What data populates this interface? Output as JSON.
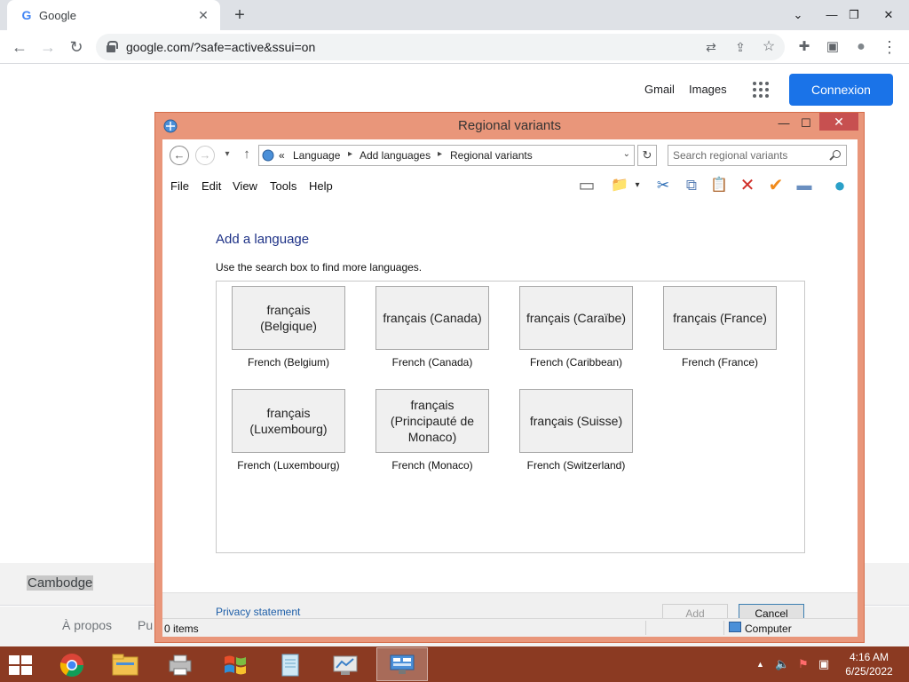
{
  "browser": {
    "tab": {
      "favicon": "G",
      "title": "Google",
      "close": "✕"
    },
    "new_tab": "+",
    "window_controls": {
      "chevron": "⌄",
      "minimize": "—",
      "restore": "❐",
      "close": "✕"
    },
    "nav": {
      "back": "←",
      "forward": "→",
      "reload": "↻"
    },
    "url": "google.com/?safe=active&ssui=on",
    "omni_icons": {
      "translate": "⇄",
      "share": "⇪",
      "bookmark": "☆"
    },
    "extensions": {
      "puzzle": "✚",
      "sidepanel": "▣",
      "profile": "●",
      "menu": "⋮"
    }
  },
  "google": {
    "gmail": "Gmail",
    "images": "Images",
    "sign_in": "Connexion",
    "country": "Cambodge",
    "footer_links": [
      "À propos",
      "Pu"
    ]
  },
  "dialog": {
    "title": "Regional variants",
    "controls": {
      "minimize": "—",
      "maximize": "☐",
      "close": "✕"
    },
    "nav": {
      "back": "←",
      "forward": "→",
      "recent": "▾",
      "up": "↑"
    },
    "breadcrumb": {
      "prefix": "«",
      "items": [
        "Language",
        "Add languages",
        "Regional variants"
      ],
      "separator": "▸",
      "dropdown": "⌄"
    },
    "refresh": "↻",
    "search_placeholder": "Search regional variants",
    "menu": [
      "File",
      "Edit",
      "View",
      "Tools",
      "Help"
    ],
    "toolbar_icons": {
      "layout": "▭",
      "folder": "📁",
      "dropdown": "▾",
      "cut": "✂",
      "copy": "⧉",
      "paste": "📋",
      "delete": "✕",
      "check": "✔",
      "rename": "▬",
      "globe": "●"
    },
    "heading": "Add a language",
    "hint": "Use the search box to find more languages.",
    "languages": [
      {
        "native": "français (Belgique)",
        "english": "French (Belgium)"
      },
      {
        "native": "français (Canada)",
        "english": "French (Canada)"
      },
      {
        "native": "français (Caraïbe)",
        "english": "French (Caribbean)"
      },
      {
        "native": "français (France)",
        "english": "French (France)"
      },
      {
        "native": "français (Luxembourg)",
        "english": "French (Luxembourg)"
      },
      {
        "native": "français (Principauté de Monaco)",
        "english": "French (Monaco)"
      },
      {
        "native": "français (Suisse)",
        "english": "French (Switzerland)"
      }
    ],
    "privacy": "Privacy statement",
    "add_button": "Add",
    "cancel_button": "Cancel",
    "status_items": "0 items",
    "status_zone": "Computer"
  },
  "taskbar": {
    "apps": [
      "chrome",
      "file-explorer",
      "printer",
      "windows-logo",
      "notepad",
      "control-panel",
      "network-settings"
    ],
    "tray": {
      "up": "▲",
      "volume": "🔈",
      "flag": "⚑",
      "network": "▣"
    },
    "time": "4:16 AM",
    "date": "6/25/2022"
  },
  "colors": {
    "accent_blue": "#1a73e8",
    "dialog_frame": "#e9967a",
    "taskbar": "#8b3a22",
    "heading": "#1e3287"
  }
}
